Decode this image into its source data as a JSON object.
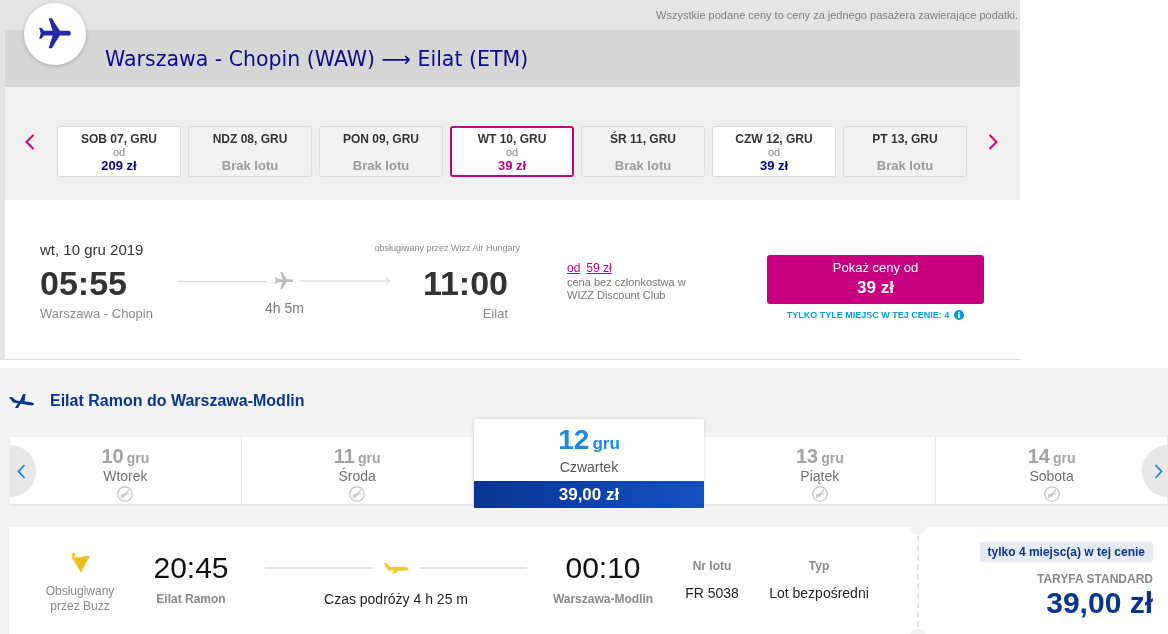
{
  "outbound": {
    "notice": "Wszystkie podane ceny to ceny za jednego pasażera zawierające podatki.",
    "title": "Warszawa - Chopin (WAW) ⟶ Eilat (ETM)",
    "date_cards": [
      {
        "kind": "price",
        "day": "SOB 07, GRU",
        "from": "od",
        "price": "209 zł",
        "selected": false
      },
      {
        "kind": "no_flight",
        "day": "NDZ 08, GRU",
        "status": "Brak lotu",
        "selected": false
      },
      {
        "kind": "no_flight",
        "day": "PON 09, GRU",
        "status": "Brak lotu",
        "selected": false
      },
      {
        "kind": "price",
        "day": "WT 10, GRU",
        "from": "od",
        "price": "39 zł",
        "selected": true
      },
      {
        "kind": "no_flight",
        "day": "ŚR 11, GRU",
        "status": "Brak lotu",
        "selected": false
      },
      {
        "kind": "price",
        "day": "CZW 12, GRU",
        "from": "od",
        "price": "39 zł",
        "selected": false
      },
      {
        "kind": "no_flight",
        "day": "PT 13, GRU",
        "status": "Brak lotu",
        "selected": false
      }
    ],
    "flight": {
      "date": "wt, 10 gru 2019",
      "departure_time": "05:55",
      "departure_airport": "Warszawa - Chopin",
      "duration": "4h 5m",
      "operator": "obsługiwany przez Wizz Air Hungary",
      "arrival_time": "11:00",
      "arrival_airport": "Eilat",
      "member_price_prefix": "od",
      "member_price": "59 zł",
      "member_note": "cena bez członkostwa w WIZZ Discount Club",
      "button_label": "Pokaż ceny od",
      "button_price": "39 zł",
      "seats_left": "TYLKO TYLE MIEJSC W TEJ CENIE: 4"
    }
  },
  "return": {
    "title": "Eilat Ramon do Warszawa-Modlin",
    "dates": [
      {
        "kind": "no_flight",
        "day": "10",
        "month": "gru",
        "weekday": "Wtorek",
        "selected": false
      },
      {
        "kind": "no_flight",
        "day": "11",
        "month": "gru",
        "weekday": "Środa",
        "selected": false
      },
      {
        "kind": "price",
        "day": "12",
        "month": "gru",
        "weekday": "Czwartek",
        "price": "39,00 zł",
        "selected": true
      },
      {
        "kind": "no_flight",
        "day": "13",
        "month": "gru",
        "weekday": "Piątek",
        "selected": false
      },
      {
        "kind": "no_flight",
        "day": "14",
        "month": "gru",
        "weekday": "Sobota",
        "selected": false
      }
    ],
    "flight": {
      "operator": "Obsługiwany przez Buzz",
      "departure_time": "20:45",
      "departure_airport": "Eilat Ramon",
      "duration": "Czas podróży 4 h 25 m",
      "arrival_time": "00:10",
      "arrival_airport": "Warszawa-Modlin",
      "flight_number_label": "Nr lotu",
      "flight_number": "FR 5038",
      "type_label": "Typ",
      "type": "Lot bezpośredni",
      "seats_badge": "tylko 4 miejsc(a) w tej cenie",
      "fare": "TARYFA STANDARD",
      "price": "39,00 zł"
    }
  }
}
